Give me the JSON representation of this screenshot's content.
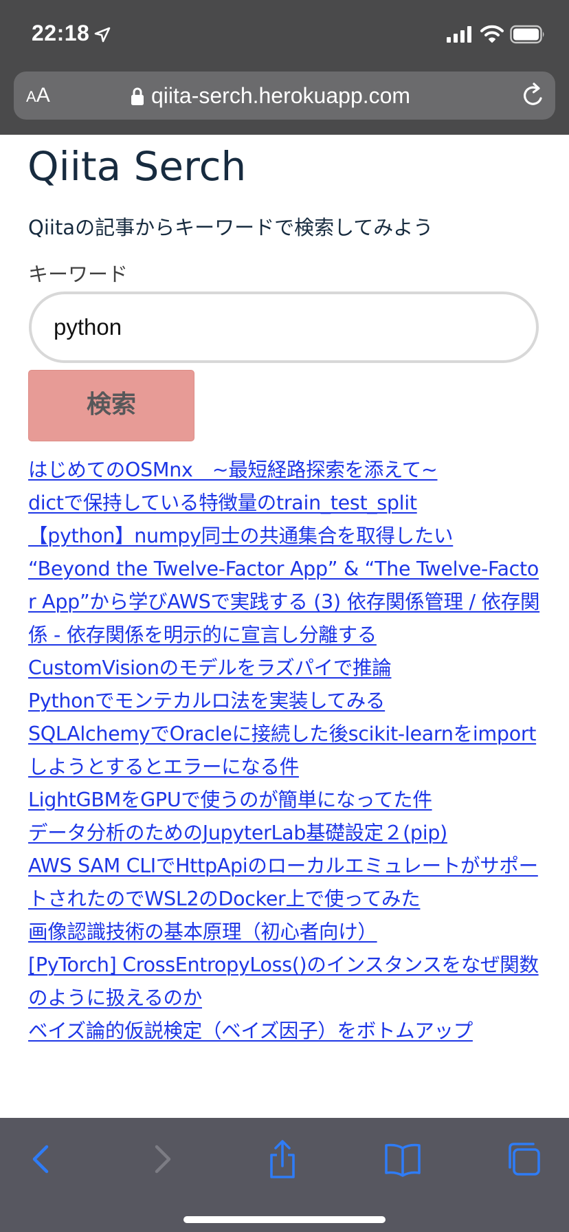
{
  "status_bar": {
    "time": "22:18",
    "icons": [
      "location-arrow-icon",
      "cellular-signal-icon",
      "wifi-icon",
      "battery-icon"
    ]
  },
  "browser": {
    "text_size_small": "A",
    "text_size_big": "A",
    "url": "qiita-serch.herokuapp.com",
    "toolbar": [
      "back-icon",
      "forward-icon",
      "share-icon",
      "bookmarks-icon",
      "tabs-icon"
    ]
  },
  "page": {
    "title": "Qiita Serch",
    "description": "Qiitaの記事からキーワードで検索してみよう",
    "keyword_label": "キーワード",
    "keyword_value": "python",
    "search_button": "検索",
    "results": [
      "はじめてのOSMnx　~最短経路探索を添えて~",
      "dictで保持している特徴量のtrain_test_split",
      "【python】numpy同士の共通集合を取得したい",
      "“Beyond the Twelve-Factor App” & “The Twelve-Factor App”から学びAWSで実践する (3) 依存関係管理 / 依存関係 - 依存関係を明示的に宣言し分離する",
      "CustomVisionのモデルをラズパイで推論",
      "Pythonでモンテカルロ法を実装してみる",
      "SQLAlchemyでOracleに接続した後scikit-learnをimportしようとするとエラーになる件",
      "LightGBMをGPUで使うのが簡単になってた件",
      "データ分析のためのJupyterLab基礎設定２(pip)",
      "AWS SAM CLIでHttpApiのローカルエミュレートがサポートされたのでWSL2のDocker上で使ってみた",
      "画像認識技術の基本原理（初心者向け）",
      "[PyTorch] CrossEntropyLoss()のインスタンスをなぜ関数のように扱えるのか",
      "ベイズ論的仮説検定（ベイズ因子）をボトムアップ"
    ]
  },
  "colors": {
    "chrome": "#4a4a4b",
    "toolbar": "#575760",
    "link": "#1d36e6",
    "button": "#e79b96",
    "title": "#172b3f"
  }
}
